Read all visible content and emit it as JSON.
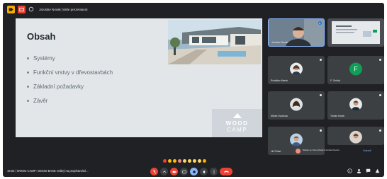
{
  "window": {
    "title": "Jaroslav Novak (Vaše prezentace)"
  },
  "slide": {
    "title": "Obsah",
    "bullets": [
      "Systémy",
      "Funkční vrstvy v dřevostavbách",
      "Základní požadavky",
      "Závěr"
    ],
    "logo_line1": "WOOD",
    "logo_line2": "CAMP"
  },
  "participants": [
    {
      "name": "Jaroslav Novák",
      "avatar": "video-feed"
    },
    {
      "name": "",
      "avatar": "presentation-preview"
    },
    {
      "name": "Rostislav Marek",
      "avatar": "photo"
    },
    {
      "name": "F. Ondřej",
      "avatar": "letter",
      "initial": "F",
      "color": "#0f9d58"
    },
    {
      "name": "Martin Svoboda",
      "avatar": "photo"
    },
    {
      "name": "Tomáš Horák",
      "avatar": "photo"
    },
    {
      "name": "Jiří Pekař",
      "avatar": "photo"
    }
  ],
  "chat_notice": {
    "text": "Někdo se chce připojit k tomuto hovoru",
    "action": "Zobrazit"
  },
  "meeting": {
    "info": "15:03 | WOOD CAMP: WOOD BASE reálný na projektování..."
  },
  "colors": {
    "background": "#202124",
    "tile": "#3c4043",
    "danger": "#ea4335",
    "accent": "#8ab4f8"
  },
  "icons": {
    "controls": [
      "mic-off-icon",
      "camera-icon",
      "captions-icon",
      "raise-hand-icon",
      "present-icon",
      "more-icon",
      "leave-call-icon"
    ],
    "right": [
      "info-icon",
      "people-icon",
      "chat-icon",
      "activities-icon"
    ]
  }
}
